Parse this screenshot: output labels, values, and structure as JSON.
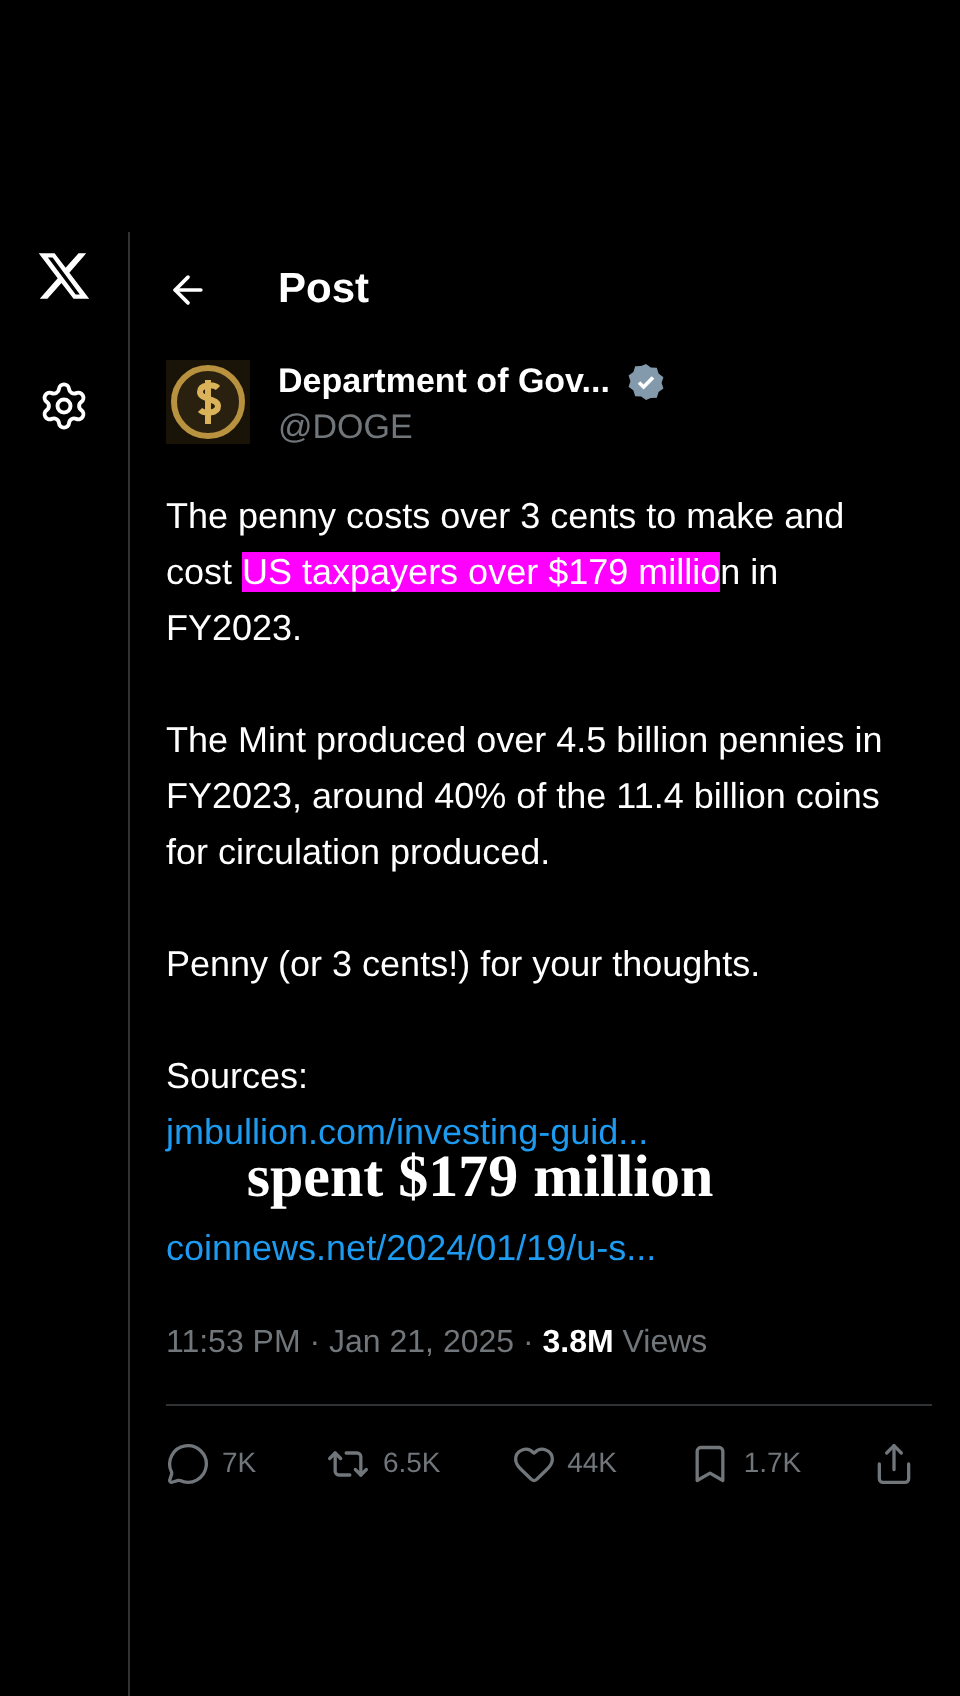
{
  "header": {
    "title": "Post"
  },
  "post": {
    "author": {
      "name": "Department of Gov...",
      "handle": "@DOGE",
      "verified": true
    },
    "paragraphs": [
      [
        {
          "text": "The penny costs over 3 cents to make and cost ",
          "highlighted": false
        },
        {
          "text": "US taxpayers over $179 millio",
          "highlighted": true
        },
        {
          "text": "n in FY2023.",
          "highlighted": false
        }
      ],
      [
        {
          "text": "The Mint produced over 4.5 billion pennies in FY2023, around 40% of the 11.4 billion coins for circulation produced.",
          "highlighted": false
        }
      ],
      [
        {
          "text": "Penny (or 3 cents!) for your thoughts.",
          "highlighted": false
        }
      ]
    ],
    "sources_label": "Sources:",
    "links": [
      "jmbullion.com/investing-guid...",
      "coinnews.net/2024/01/19/u-s..."
    ],
    "timestamp": "11:53 PM · Jan 21, 2025 · ",
    "views_count": "3.8M",
    "views_label": " Views",
    "actions": [
      {
        "kind": "reply",
        "count": "7K"
      },
      {
        "kind": "repost",
        "count": "6.5K"
      },
      {
        "kind": "like",
        "count": "44K"
      },
      {
        "kind": "bookmark",
        "count": "1.7K"
      },
      {
        "kind": "share"
      }
    ]
  },
  "caption": "spent $179 million"
}
